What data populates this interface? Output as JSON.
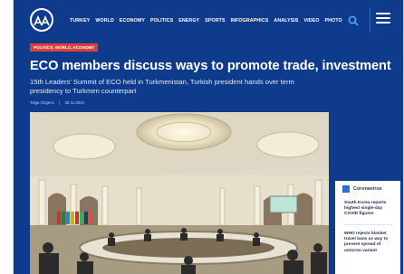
{
  "nav": {
    "logo_icon": "aa-logo-icon",
    "items": [
      "TURKEY",
      "WORLD",
      "ECONOMY",
      "POLITICS",
      "ENERGY",
      "SPORTS",
      "INFOGRAPHICS",
      "ANALYSIS",
      "VIDEO",
      "PHOTO"
    ],
    "search_icon": "search-icon",
    "menu_icon": "hamburger-menu-icon"
  },
  "article": {
    "category": "POLITICS, WORLD, ECONOMY",
    "headline": "ECO members discuss ways to promote trade, investment",
    "subhead": "15th Leaders' Summit of ECO held in Turkmenistan, Turkish president hands over term presidency to Turkmen counterpart",
    "author": "Tolga Ozgenc",
    "separator": "|",
    "date": "28.11.2021",
    "photo_icon": "summit-photo"
  },
  "sidebar": {
    "section_title": "Coronavirus",
    "items": [
      "South Korea reports highest single-day COVID figures",
      "WHO rejects blanket travel bans as way to prevent spread of omicron variant"
    ]
  },
  "colors": {
    "brand_blue": "#0e3b8c",
    "category_red": "#d8423a",
    "accent_blue": "#2a6fd6"
  }
}
